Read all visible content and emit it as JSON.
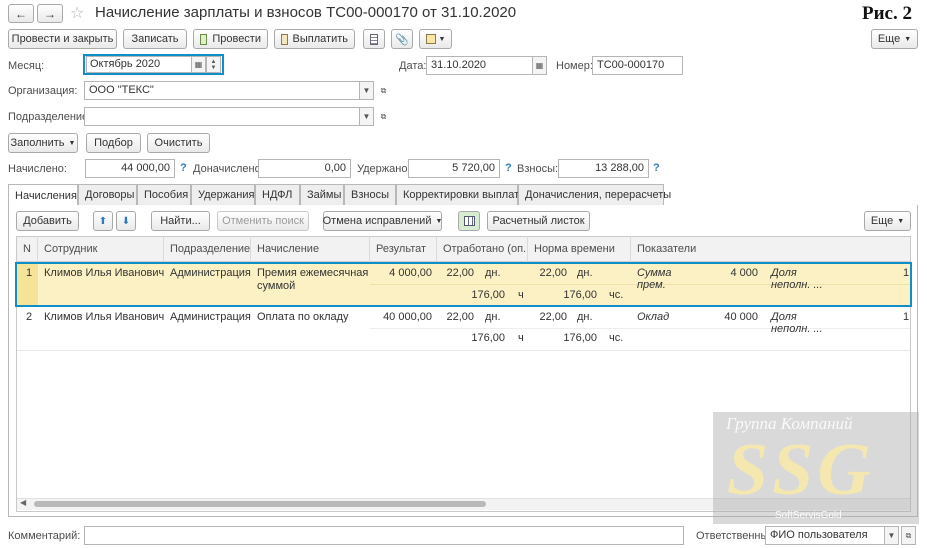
{
  "window": {
    "title": "Начисление зарплаты и взносов ТС00-000170 от 31.10.2020"
  },
  "caption": "Рис. 2",
  "toolbar": {
    "post_close": "Провести и закрыть",
    "save": "Записать",
    "post": "Провести",
    "pay": "Выплатить",
    "more": "Еще"
  },
  "header": {
    "month_label": "Месяц:",
    "month_value": "Октябрь 2020",
    "date_label": "Дата:",
    "date_value": "31.10.2020",
    "number_label": "Номер:",
    "number_value": "ТС00-000170",
    "org_label": "Организация:",
    "org_value": "ООО \"ТЕКС\"",
    "dept_label": "Подразделение:",
    "dept_value": ""
  },
  "actions": {
    "fill": "Заполнить",
    "select": "Подбор",
    "clear": "Очистить"
  },
  "totals": {
    "accrued_label": "Начислено:",
    "accrued_value": "44 000,00",
    "extra_label": "Доначислено:",
    "extra_value": "0,00",
    "withheld_label": "Удержано:",
    "withheld_value": "5 720,00",
    "contrib_label": "Взносы:",
    "contrib_value": "13 288,00"
  },
  "tabs": [
    "Начисления",
    "Договоры",
    "Пособия",
    "Удержания",
    "НДФЛ",
    "Займы",
    "Взносы",
    "Корректировки выплаты",
    "Доначисления, перерасчеты"
  ],
  "table_toolbar": {
    "add": "Добавить",
    "find": "Найти...",
    "cancel_search": "Отменить поиск",
    "undo_fix": "Отмена исправлений",
    "payslip": "Расчетный листок",
    "more": "Еще"
  },
  "columns": [
    "N",
    "Сотрудник",
    "Подразделение",
    "Начисление",
    "Результат",
    "Отработано (оп...",
    "Норма времени",
    "Показатели"
  ],
  "rows": [
    {
      "n": "1",
      "employee": "Климов Илья Иванович",
      "dept": "Администрация",
      "accrual1": "Премия ежемесячная",
      "accrual2": "суммой",
      "result": "4 000,00",
      "worked_days": "22,00",
      "worked_days_unit": "дн.",
      "worked_hours": "176,00",
      "worked_hours_unit": "ч",
      "norm_days": "22,00",
      "norm_days_unit": "дн.",
      "norm_hours": "176,00",
      "norm_hours_unit": "чс.",
      "ind_name1": "Сумма",
      "ind_name2": "прем.",
      "ind_value": "4 000",
      "ind2_name1": "Доля",
      "ind2_name2": "неполн. ...",
      "tail": "1"
    },
    {
      "n": "2",
      "employee": "Климов Илья Иванович",
      "dept": "Администрация",
      "accrual1": "Оплата по окладу",
      "accrual2": "",
      "result": "40 000,00",
      "worked_days": "22,00",
      "worked_days_unit": "дн.",
      "worked_hours": "176,00",
      "worked_hours_unit": "ч",
      "norm_days": "22,00",
      "norm_days_unit": "дн.",
      "norm_hours": "176,00",
      "norm_hours_unit": "чс.",
      "ind_name1": "Оклад",
      "ind_name2": "",
      "ind_value": "40 000",
      "ind2_name1": "Доля",
      "ind2_name2": "неполн. ...",
      "tail": "1"
    }
  ],
  "footer": {
    "comment_label": "Комментарий:",
    "comment_value": "",
    "responsible_label": "Ответственный:",
    "responsible_value": "ФИО пользователя"
  },
  "watermark": {
    "line1": "Группа Компаний",
    "logo": "SSG",
    "line2": "SoftServisGold"
  },
  "colors": {
    "highlight": "#0e8fc8",
    "selected_row": "#fbf1c4",
    "selected_cell": "#f5e39a",
    "tab_active": "#ffffff"
  }
}
